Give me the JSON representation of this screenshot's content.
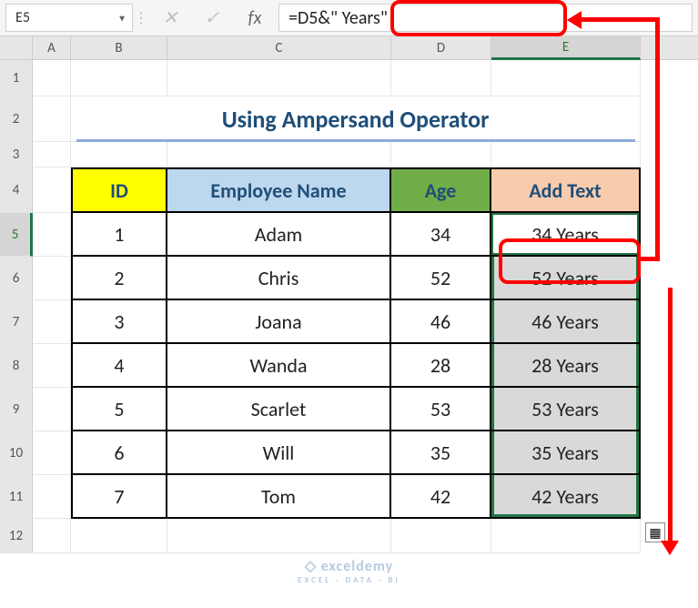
{
  "namebox": {
    "value": "E5"
  },
  "formula_bar": {
    "fx_label": "fx",
    "formula": "=D5&\" Years\""
  },
  "columns": [
    "A",
    "B",
    "C",
    "D",
    "E"
  ],
  "row_numbers": [
    1,
    2,
    3,
    4,
    5,
    6,
    7,
    8,
    9,
    10,
    11,
    12
  ],
  "title": "Using Ampersand Operator",
  "headers": {
    "id": "ID",
    "name": "Employee Name",
    "age": "Age",
    "add": "Add Text"
  },
  "rows": [
    {
      "id": 1,
      "name": "Adam",
      "age": 34,
      "add": "34 Years"
    },
    {
      "id": 2,
      "name": "Chris",
      "age": 52,
      "add": "52 Years"
    },
    {
      "id": 3,
      "name": "Joana",
      "age": 46,
      "add": "46 Years"
    },
    {
      "id": 4,
      "name": "Wanda",
      "age": 28,
      "add": "28 Years"
    },
    {
      "id": 5,
      "name": "Scarlet",
      "age": 53,
      "add": "53 Years"
    },
    {
      "id": 6,
      "name": "Will",
      "age": 35,
      "add": "35 Years"
    },
    {
      "id": 7,
      "name": "Tom",
      "age": 42,
      "add": "42 Years"
    }
  ],
  "watermark": {
    "brand": "exceldemy",
    "sub": "EXCEL · DATA · BI"
  },
  "icons": {
    "cancel": "✕",
    "enter": "✓",
    "dropdown": "▼",
    "autofill": "▦"
  }
}
